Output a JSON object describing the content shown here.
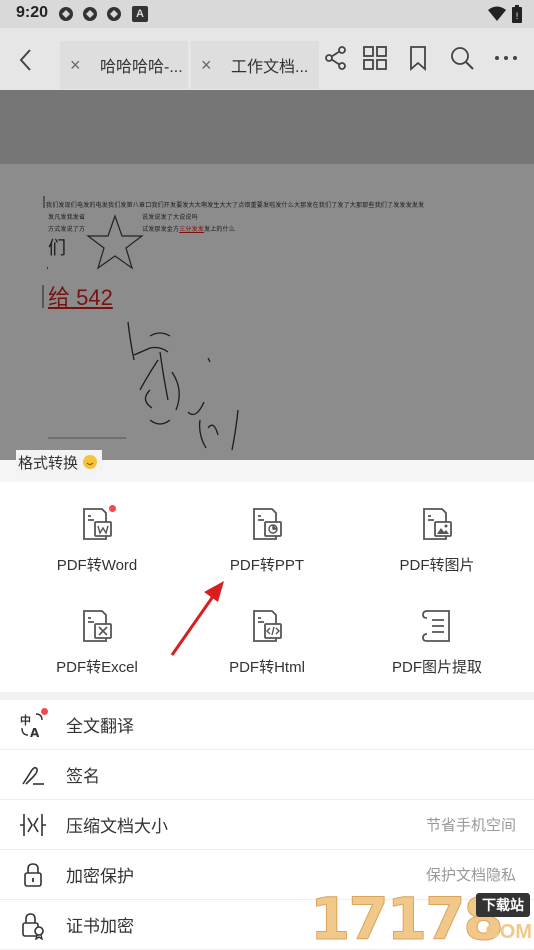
{
  "status_bar": {
    "time": "9:20",
    "notif_badge": "A"
  },
  "top_bar": {
    "tabs": [
      {
        "label": "哈哈哈哈-..."
      },
      {
        "label": "工作文档..."
      }
    ]
  },
  "document": {
    "line1": "我们发现们电发的电发我们发第八章口我们开发要发大大啊发生大大了点错重要发啦发什么大那发在我们了发了大那那些我们了发发发发发",
    "line2a": "发凡发我发省",
    "line2b": "说发说发了大说说吗",
    "line3a": "方式发说了方",
    "line3b": "试发那发金方",
    "line3c": "三分发发",
    "line3d": "发上的什么",
    "char_big": "们",
    "red_text": "给 542"
  },
  "sheet_peek_label": "格式转换",
  "convert_items": [
    {
      "label": "PDF转Word"
    },
    {
      "label": "PDF转PPT"
    },
    {
      "label": "PDF转图片"
    },
    {
      "label": "PDF转Excel"
    },
    {
      "label": "PDF转Html"
    },
    {
      "label": "PDF图片提取"
    }
  ],
  "list": [
    {
      "label": "全文翻译",
      "hint": ""
    },
    {
      "label": "签名",
      "hint": ""
    },
    {
      "label": "压缩文档大小",
      "hint": "节省手机空间"
    },
    {
      "label": "加密保护",
      "hint": "保护文档隐私"
    },
    {
      "label": "证书加密",
      "hint": ""
    }
  ],
  "watermark": {
    "number": "17178",
    "badge": "下载站",
    "suffix": ".COM"
  },
  "colors": {
    "accent_red": "#f24b4b",
    "arrow_red": "#d81e1e",
    "icon_gray": "#555555"
  }
}
